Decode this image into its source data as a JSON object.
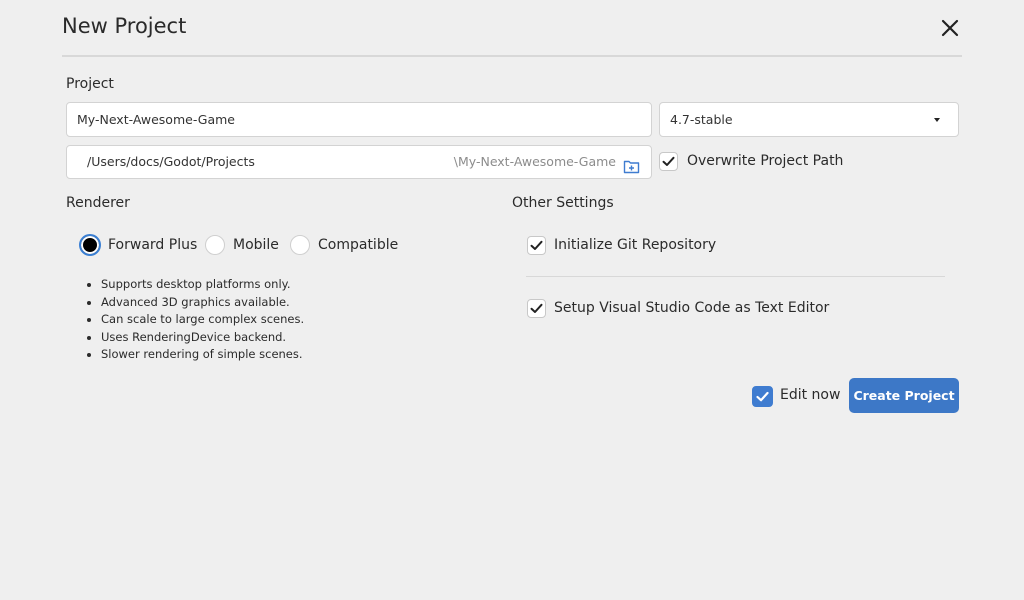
{
  "dialog": {
    "title": "New Project"
  },
  "project": {
    "section_label": "Project",
    "name_value": "My-Next-Awesome-Game",
    "version_value": "4.7-stable",
    "path_value": "/Users/docs/Godot/Projects",
    "path_suffix": "\\My-Next-Awesome-Game",
    "overwrite_label": "Overwrite Project Path",
    "overwrite_checked": true
  },
  "renderer": {
    "section_label": "Renderer",
    "options": [
      {
        "label": "Forward Plus",
        "selected": true
      },
      {
        "label": "Mobile",
        "selected": false
      },
      {
        "label": "Compatible",
        "selected": false
      }
    ],
    "notes": [
      "Supports desktop platforms only.",
      "Advanced 3D graphics available.",
      "Can scale to large complex scenes.",
      "Uses RenderingDevice backend.",
      "Slower rendering of simple scenes."
    ]
  },
  "other_settings": {
    "section_label": "Other Settings",
    "git_label": "Initialize Git Repository",
    "git_checked": true,
    "vscode_label": "Setup Visual Studio Code as Text Editor",
    "vscode_checked": true
  },
  "footer": {
    "edit_now_label": "Edit now",
    "edit_now_checked": true,
    "create_label": "Create Project"
  },
  "colors": {
    "accent": "#3d78c7",
    "background": "#efefef",
    "radio_ring": "#3a7fd3"
  },
  "icons": {
    "close": "close-icon",
    "folder": "folder-plus-icon",
    "dropdown": "chevron-down-icon",
    "check": "check-icon"
  }
}
